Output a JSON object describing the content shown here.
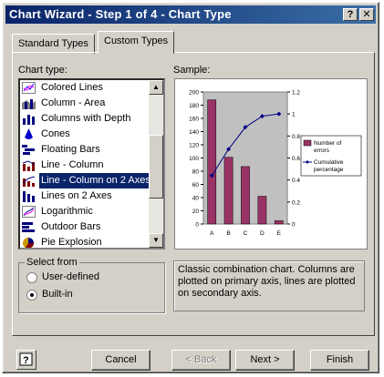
{
  "window": {
    "title": "Chart Wizard - Step 1 of 4 - Chart Type",
    "help_glyph": "?",
    "close_glyph": "✕"
  },
  "tabs": [
    {
      "label": "Standard Types",
      "active": false
    },
    {
      "label": "Custom Types",
      "active": true
    }
  ],
  "chart_type": {
    "label": "Chart type:",
    "items": [
      {
        "label": "Colored Lines",
        "icon": "colored-lines-icon"
      },
      {
        "label": "Column - Area",
        "icon": "column-area-icon"
      },
      {
        "label": "Columns with Depth",
        "icon": "columns-depth-icon"
      },
      {
        "label": "Cones",
        "icon": "cones-icon"
      },
      {
        "label": "Floating Bars",
        "icon": "floating-bars-icon"
      },
      {
        "label": "Line - Column",
        "icon": "line-column-icon"
      },
      {
        "label": "Line - Column on 2 Axes",
        "icon": "line-column-2axes-icon",
        "selected": true
      },
      {
        "label": "Lines on 2 Axes",
        "icon": "lines-2axes-icon"
      },
      {
        "label": "Logarithmic",
        "icon": "logarithmic-icon"
      },
      {
        "label": "Outdoor Bars",
        "icon": "outdoor-bars-icon"
      },
      {
        "label": "Pie Explosion",
        "icon": "pie-explosion-icon"
      }
    ]
  },
  "sample": {
    "label": "Sample:"
  },
  "select_from": {
    "label": "Select from",
    "options": [
      {
        "label": "User-defined",
        "checked": false
      },
      {
        "label": "Built-in",
        "checked": true
      }
    ]
  },
  "description": "Classic combination chart. Columns are plotted on primary axis, lines are plotted on secondary axis.",
  "buttons": {
    "help": "?",
    "cancel": "Cancel",
    "back": "< Back",
    "next": "Next >",
    "finish": "Finish"
  },
  "colors": {
    "title_start": "#0a246a",
    "title_end": "#3a6ea5",
    "bar_fill": "#993366",
    "line": "#000080",
    "plot_bg": "#c0c0c0"
  },
  "chart_data": {
    "type": "bar",
    "categories": [
      "A",
      "B",
      "C",
      "D",
      "E"
    ],
    "series": [
      {
        "name": "Number of errors",
        "type": "bar",
        "axis": "primary",
        "values": [
          188,
          101,
          87,
          42,
          5
        ]
      },
      {
        "name": "Cumulative percentage",
        "type": "line",
        "axis": "secondary",
        "values": [
          0.44,
          0.68,
          0.88,
          0.98,
          1.0
        ]
      }
    ],
    "ylim": [
      0,
      200
    ],
    "y_ticks": [
      "0",
      "20",
      "40",
      "60",
      "80",
      "100",
      "120",
      "140",
      "160",
      "180",
      "200"
    ],
    "y2lim": [
      0,
      1.2
    ],
    "y2_ticks": [
      "0",
      "0.2",
      "0.4",
      "0.6",
      "0.8",
      "1",
      "1.2"
    ],
    "legend": "right",
    "grid": false
  }
}
